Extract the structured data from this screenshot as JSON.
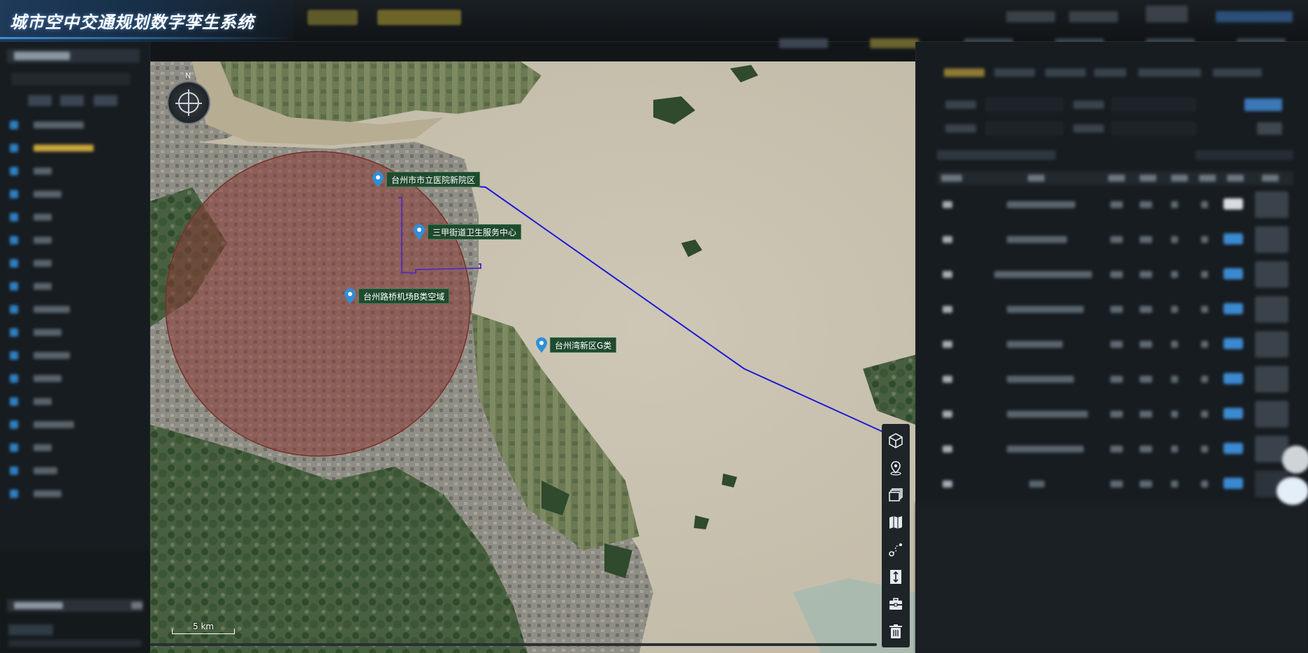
{
  "app": {
    "title": "城市空中交通规划数字孪生系统"
  },
  "map": {
    "compass_label": "N",
    "scale_label": "5 km",
    "pois": [
      {
        "label": "台州市市立医院新院区"
      },
      {
        "label": "三甲街道卫生服务中心"
      },
      {
        "label": "台州路桥机场B类空域"
      },
      {
        "label": "台州湾新区G类"
      }
    ],
    "colors": {
      "coverage_circle": "#8a3a36",
      "flight_line": "#1a1ad6",
      "route_line": "#5a2fb8",
      "poi_pin": "#2f8fd8",
      "label_bg": "#1f4a2e"
    }
  },
  "toolbar": {
    "tools": [
      {
        "icon": "cube-icon"
      },
      {
        "icon": "location-pin-icon"
      },
      {
        "icon": "layers-icon"
      },
      {
        "icon": "map-icon"
      },
      {
        "icon": "route-icon"
      },
      {
        "icon": "measure-icon"
      },
      {
        "icon": "toolbox-icon"
      },
      {
        "icon": "trash-icon"
      }
    ]
  }
}
